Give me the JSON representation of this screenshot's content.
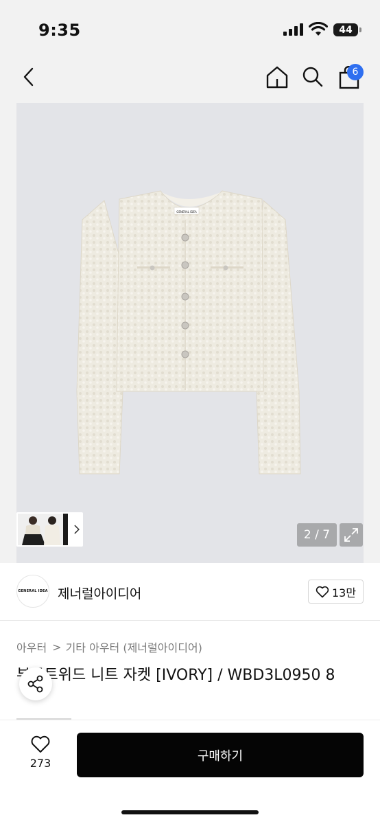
{
  "status_bar": {
    "time": "9:35",
    "battery": "44"
  },
  "nav": {
    "back_icon": "chevron-left-icon",
    "home_icon": "home-icon",
    "search_icon": "search-icon",
    "cart_icon": "shopping-bag-icon",
    "cart_count": "6",
    "badge_color": "#2f6ff0"
  },
  "gallery": {
    "counter": "2 / 7",
    "label_text": "GENERAL IDEA",
    "expand_icon": "expand-icon",
    "thumb_chevron": "chevron-right-icon"
  },
  "brand": {
    "logo_text": "GENERAL IDEA",
    "name": "제너럴아이디어",
    "like_count": "13만"
  },
  "breadcrumb": {
    "first": "아우터",
    "separator": ">",
    "second": "기타 아우터 (제너럴아이디어)"
  },
  "product": {
    "title": "부클트위드 니트 자켓 [IVORY] / WBD3L0950 8"
  },
  "bottom": {
    "wish_count": "273",
    "buy_label": "구매하기",
    "buy_color": "#050505"
  }
}
